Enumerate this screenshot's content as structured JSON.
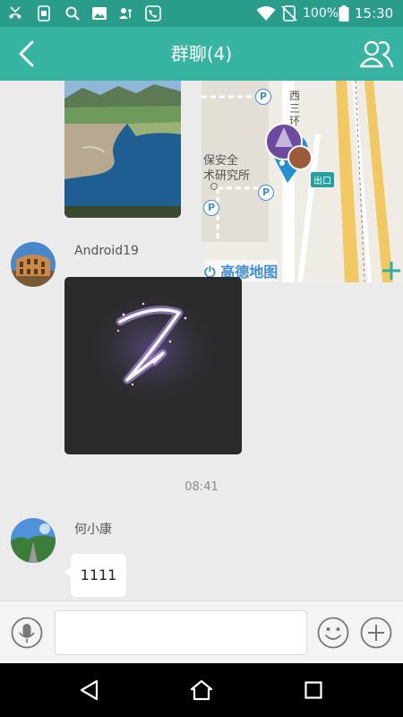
{
  "status_bar": {
    "battery": "100%",
    "time": "15:30"
  },
  "header": {
    "title": "群聊(4)"
  },
  "map": {
    "poi_labels": [
      "保安全",
      "术研究所"
    ],
    "road_label": "西三环",
    "exit_label": "出口",
    "logo": "高德地图",
    "parking_symbol": "P"
  },
  "messages": {
    "sender_1": "Android19",
    "timestamp": "08:41",
    "sender_2": "何小康",
    "text_message": "1111"
  },
  "colors": {
    "status_bar": "#2a9d8a",
    "header": "#37b3a1",
    "background": "#ebebeb"
  }
}
